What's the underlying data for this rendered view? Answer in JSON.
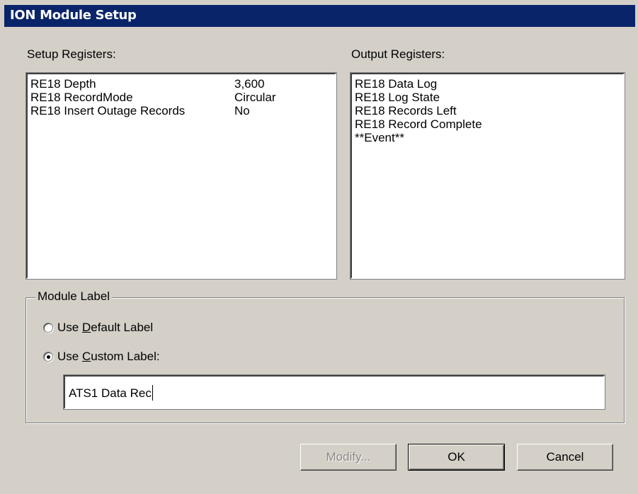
{
  "window": {
    "title": "ION Module Setup"
  },
  "setup": {
    "label": "Setup Registers:",
    "rows": [
      {
        "name": "RE18 Depth",
        "value": "3,600"
      },
      {
        "name": "RE18 RecordMode",
        "value": "Circular"
      },
      {
        "name": "RE18 Insert Outage Records",
        "value": "No"
      }
    ]
  },
  "output": {
    "label": "Output Registers:",
    "items": [
      "RE18 Data Log",
      "RE18 Log State",
      "RE18 Records Left",
      "RE18 Record Complete",
      "**Event**"
    ]
  },
  "module_label": {
    "caption": "Module Label",
    "default_option": {
      "pre": "Use ",
      "accel": "D",
      "post": "efault Label",
      "selected": false
    },
    "custom_option": {
      "pre": "Use ",
      "accel": "C",
      "post": "ustom Label:",
      "selected": true
    },
    "custom_value": "ATS1 Data Rec"
  },
  "buttons": {
    "modify": "Modify...",
    "ok": "OK",
    "cancel": "Cancel",
    "modify_enabled": false
  }
}
